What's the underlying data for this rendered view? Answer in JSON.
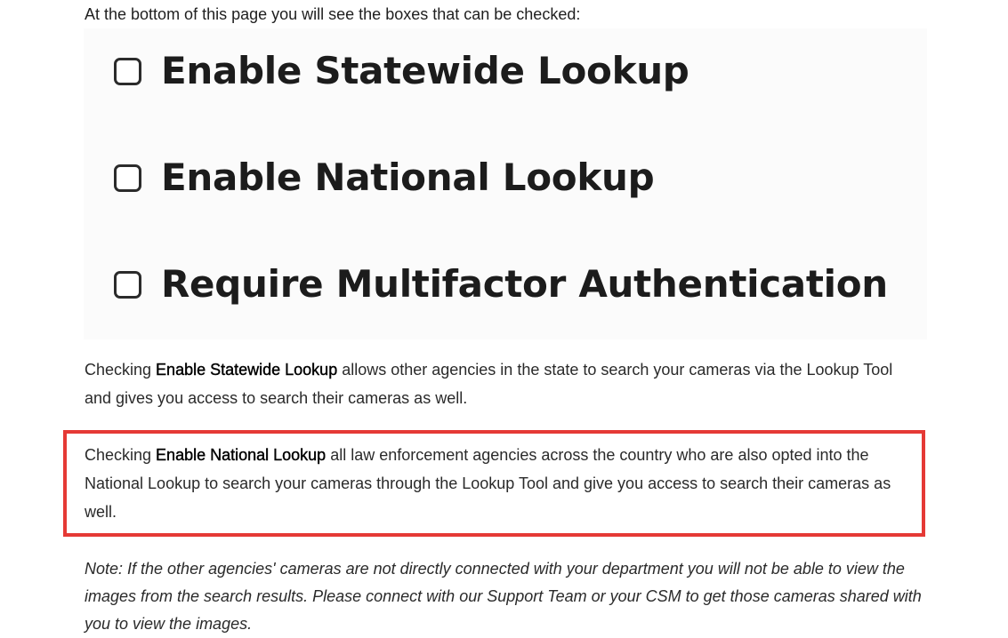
{
  "intro": "At the bottom of this page you will see the boxes that can be checked:",
  "checkboxes": [
    {
      "label": "Enable Statewide Lookup",
      "checked": false
    },
    {
      "label": "Enable National Lookup",
      "checked": false
    },
    {
      "label": "Require Multifactor Authentication",
      "checked": false
    }
  ],
  "paragraph1": {
    "prefix": "Checking ",
    "bold": "Enable Statewide Lookup",
    "suffix": " allows other agencies in the state to search your cameras via the Lookup Tool and gives you access to search their cameras as well."
  },
  "paragraph2": {
    "prefix": "Checking ",
    "bold": "Enable National Lookup",
    "suffix": " all law enforcement agencies across the country who are also opted into the National Lookup to search your cameras through the Lookup Tool and give you access to search their cameras as well."
  },
  "note": "Note: If the other agencies' cameras are not directly connected with your department you will not be able to view the images from the search results. Please connect with our Support Team or your CSM to get those cameras shared with you to view the images.",
  "colors": {
    "highlight_border": "#e53935",
    "panel_background": "#fbfbfb"
  }
}
